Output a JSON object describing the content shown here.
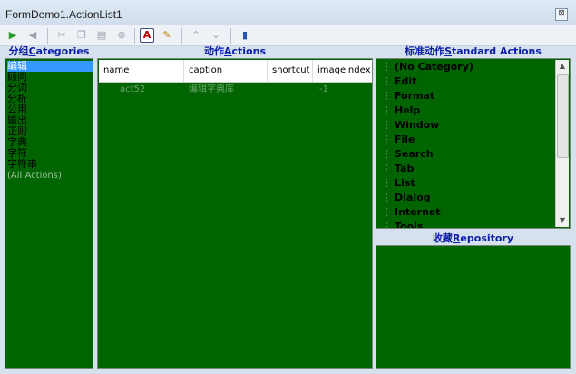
{
  "window": {
    "title": "FormDemo1.ActionList1",
    "close_glyph": "⊠"
  },
  "toolbar": {
    "icons": [
      "new-action-icon",
      "back-icon",
      "cut-icon",
      "copy-icon",
      "paste-icon",
      "delete-icon",
      "text-caption-icon",
      "brush-icon",
      "move-up-icon",
      "move-down-icon",
      "help-book-icon"
    ]
  },
  "categories": {
    "header_cn": "分组",
    "header_en_key": "C",
    "header_en_rest": "ategories",
    "items": [
      "编辑",
      "顾问",
      "分词",
      "分析",
      "公用",
      "输出",
      "正则",
      "字典",
      "字符",
      "字符串"
    ],
    "all_actions": "(All Actions)"
  },
  "actions": {
    "header_cn": "动作",
    "header_en_key": "A",
    "header_en_rest": "ctions",
    "columns": [
      "name",
      "caption",
      "shortcut",
      "imageindex"
    ],
    "rows": [
      {
        "name": "act52",
        "caption": "编辑字典库",
        "shortcut": "",
        "imageindex": "-1"
      }
    ]
  },
  "standard": {
    "header_cn": "标准动作",
    "header_en_key": "S",
    "header_en_rest": "tandard Actions",
    "items": [
      "(No Category)",
      "Edit",
      "Format",
      "Help",
      "Window",
      "File",
      "Search",
      "Tab",
      "List",
      "Dialog",
      "Internet",
      "Tools"
    ]
  },
  "repository": {
    "header_cn": "收藏",
    "header_en_key": "R",
    "header_en_rest": "epository"
  },
  "colors": {
    "pane_bg": "#006400",
    "selection": "#3399ff",
    "header_text": "#0b1ea6"
  }
}
